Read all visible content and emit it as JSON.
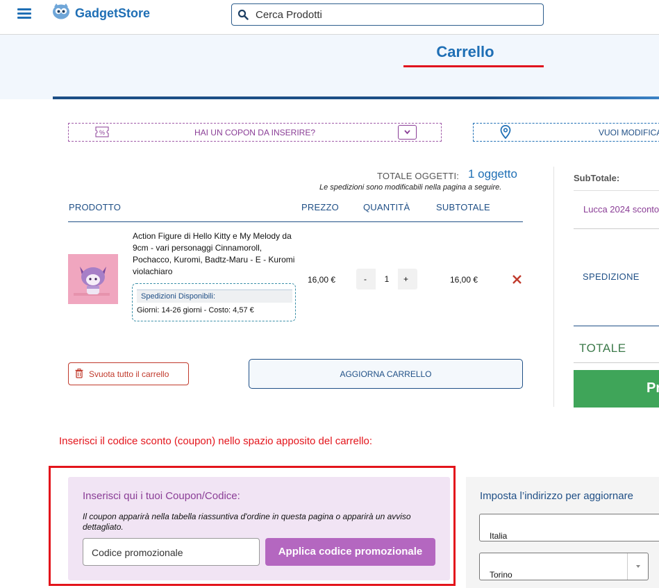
{
  "header": {
    "brand": "GadgetStore",
    "search_placeholder": "Cerca Prodotti",
    "accent_color": "#1f6fb5"
  },
  "page": {
    "title": "Carrello"
  },
  "toggles": {
    "coupon_label": "HAI UN COPON DA INSERIRE?",
    "address_label": "VUOI MODIFICA"
  },
  "cart": {
    "total_items_label": "TOTALE OGGETTI:",
    "total_items_value": "1 oggetto",
    "shipping_note": "Le spedizioni sono modificabili nella pagina a seguire.",
    "columns": {
      "product": "PRODOTTO",
      "price": "PREZZO",
      "quantity": "QUANTITÀ",
      "subtotal": "SUBTOTALE"
    },
    "items": [
      {
        "name": "Action Figure di Hello Kitty e My Melody da 9cm - vari personaggi Cinnamoroll, Pochacco, Kuromi, Badtz-Maru - E - Kuromi violachiaro",
        "shipping_header": "Spedizioni Disponibili:",
        "shipping_detail": "Giorni: 14-26 giorni - Costo: 4,57 €",
        "price": "16,00 €",
        "qty_minus": "-",
        "qty": "1",
        "qty_plus": "+",
        "subtotal": "16,00 €"
      }
    ],
    "empty_label": "Svuota tutto il carrello",
    "update_label": "AGGIORNA CARRELLO"
  },
  "sidebar": {
    "subtotal_label": "SubTotale:",
    "promo_line": "Lucca 2024 sconto",
    "shipping_label": "SPEDIZIONE",
    "total_label": "TOTALE",
    "proceed_label": "Pr"
  },
  "instruction": "Inserisci il codice sconto (coupon) nello spazio apposito del carrello:",
  "coupon": {
    "title": "Inserisci qui i tuoi Coupon/Codice:",
    "description": "Il coupon apparirà nella tabella riassuntiva d'ordine in questa pagina o apparirà un avviso dettagliato.",
    "input_value": "Codice promozionale",
    "apply_label": "Applica codice promozionale"
  },
  "address": {
    "title": "Imposta l’indirizzo per aggiornare",
    "country": "Italia",
    "city": "Torino"
  }
}
